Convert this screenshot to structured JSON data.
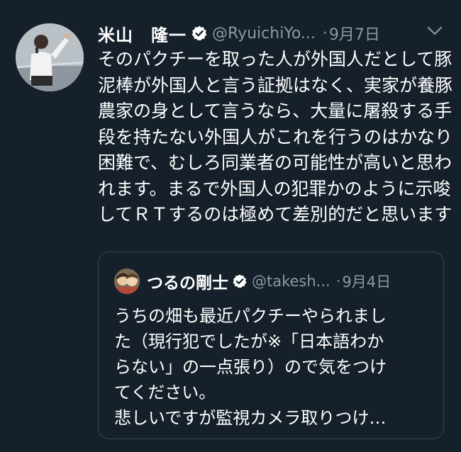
{
  "tweet": {
    "author_name": "米山　隆一",
    "handle": "@RyuichiYo...",
    "separator": "·",
    "date": "9月7日",
    "text": "そのパクチーを取った人が外国人だとして豚泥棒が外国人と言う証拠はなく、実家が養豚農家の身として言うなら、大量に屠殺する手段を持たない外国人がこれを行うのはかなり困難で、むしろ同業者の可能性が高いと思われます。まるで外国人の犯罪かのように示唆してＲＴするのは極めて差別的だと思います",
    "verified_icon": "verified-badge-icon",
    "menu_icon": "chevron-down-icon",
    "colors": {
      "background": "#15202b",
      "text": "#ffffff",
      "secondary": "#8899a6",
      "border": "#38444d"
    }
  },
  "quote": {
    "author_name": "つるの剛士",
    "handle": "@takesh...",
    "separator": "·",
    "date": "9月4日",
    "text_lines": [
      "うちの畑も最近パクチーやられまし",
      "た（現行犯でしたが※「日本語わか",
      "らない」の一点張り）ので気をつけ",
      "てください。",
      "悲しいですが監視カメラ取りつけ…"
    ]
  }
}
